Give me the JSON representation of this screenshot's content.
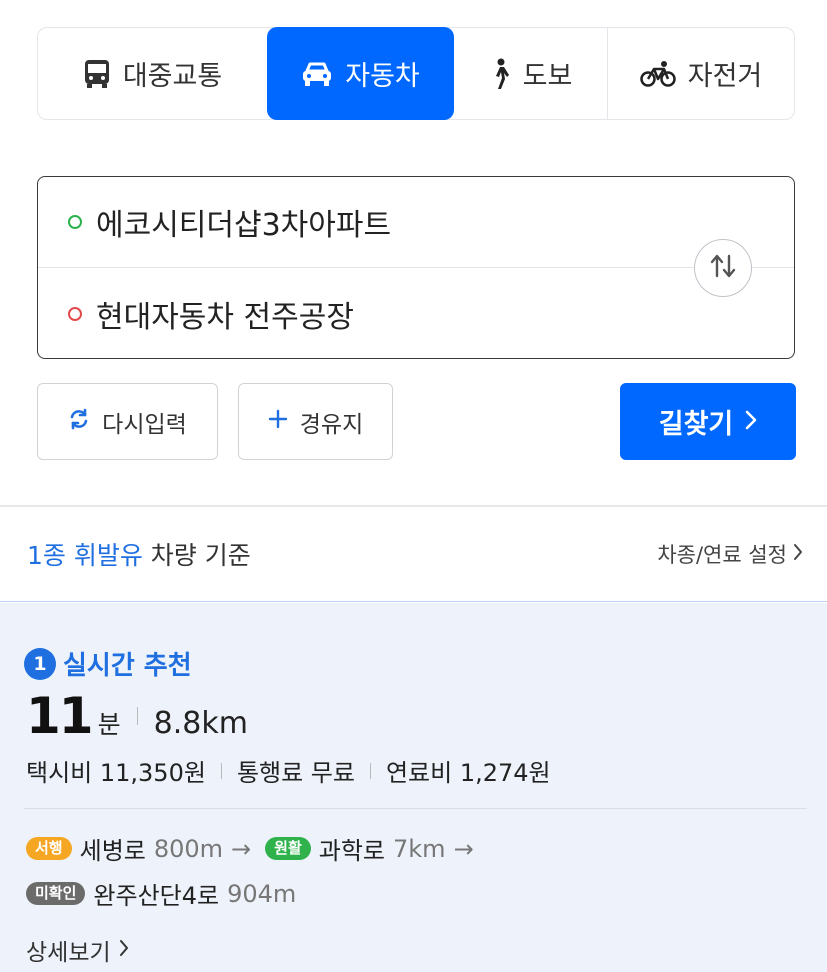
{
  "mode_tabs": [
    {
      "label": "대중교통",
      "icon": "bus-icon",
      "active": false
    },
    {
      "label": "자동차",
      "icon": "car-icon",
      "active": true
    },
    {
      "label": "도보",
      "icon": "walk-icon",
      "active": false
    },
    {
      "label": "자전거",
      "icon": "bicycle-icon",
      "active": false
    }
  ],
  "route": {
    "origin": "에코시티더샵3차아파트",
    "destination": "현대자동차 전주공장"
  },
  "actions": {
    "reset_label": "다시입력",
    "waypoint_label": "경유지",
    "search_label": "길찾기"
  },
  "vehicle_basis": {
    "highlight": "1종 휘발유",
    "rest": " 차량 기준",
    "settings_link": "차종/연료 설정"
  },
  "result": {
    "rank": "1",
    "label": "실시간 추천",
    "time_value": "11",
    "time_unit": "분",
    "distance": "8.8km",
    "taxi_fare": "택시비 11,350원",
    "toll": "통행료 무료",
    "fuel_cost": "연료비 1,274원",
    "segments": [
      {
        "status": "서행",
        "road": "세병로",
        "length": "800m",
        "arrow": "→"
      },
      {
        "status": "원활",
        "road": "과학로",
        "length": "7km",
        "arrow": "→"
      },
      {
        "status": "미확인",
        "road": "완주산단4로",
        "length": "904m",
        "arrow": ""
      }
    ],
    "detail_link": "상세보기"
  },
  "colors": {
    "primary": "#0068ff",
    "link_blue": "#1f6fe0",
    "card_bg": "#eef3fb",
    "status_slow": "#f5a623",
    "status_smooth": "#2fb24c",
    "status_unknown": "#6b6b6b"
  }
}
